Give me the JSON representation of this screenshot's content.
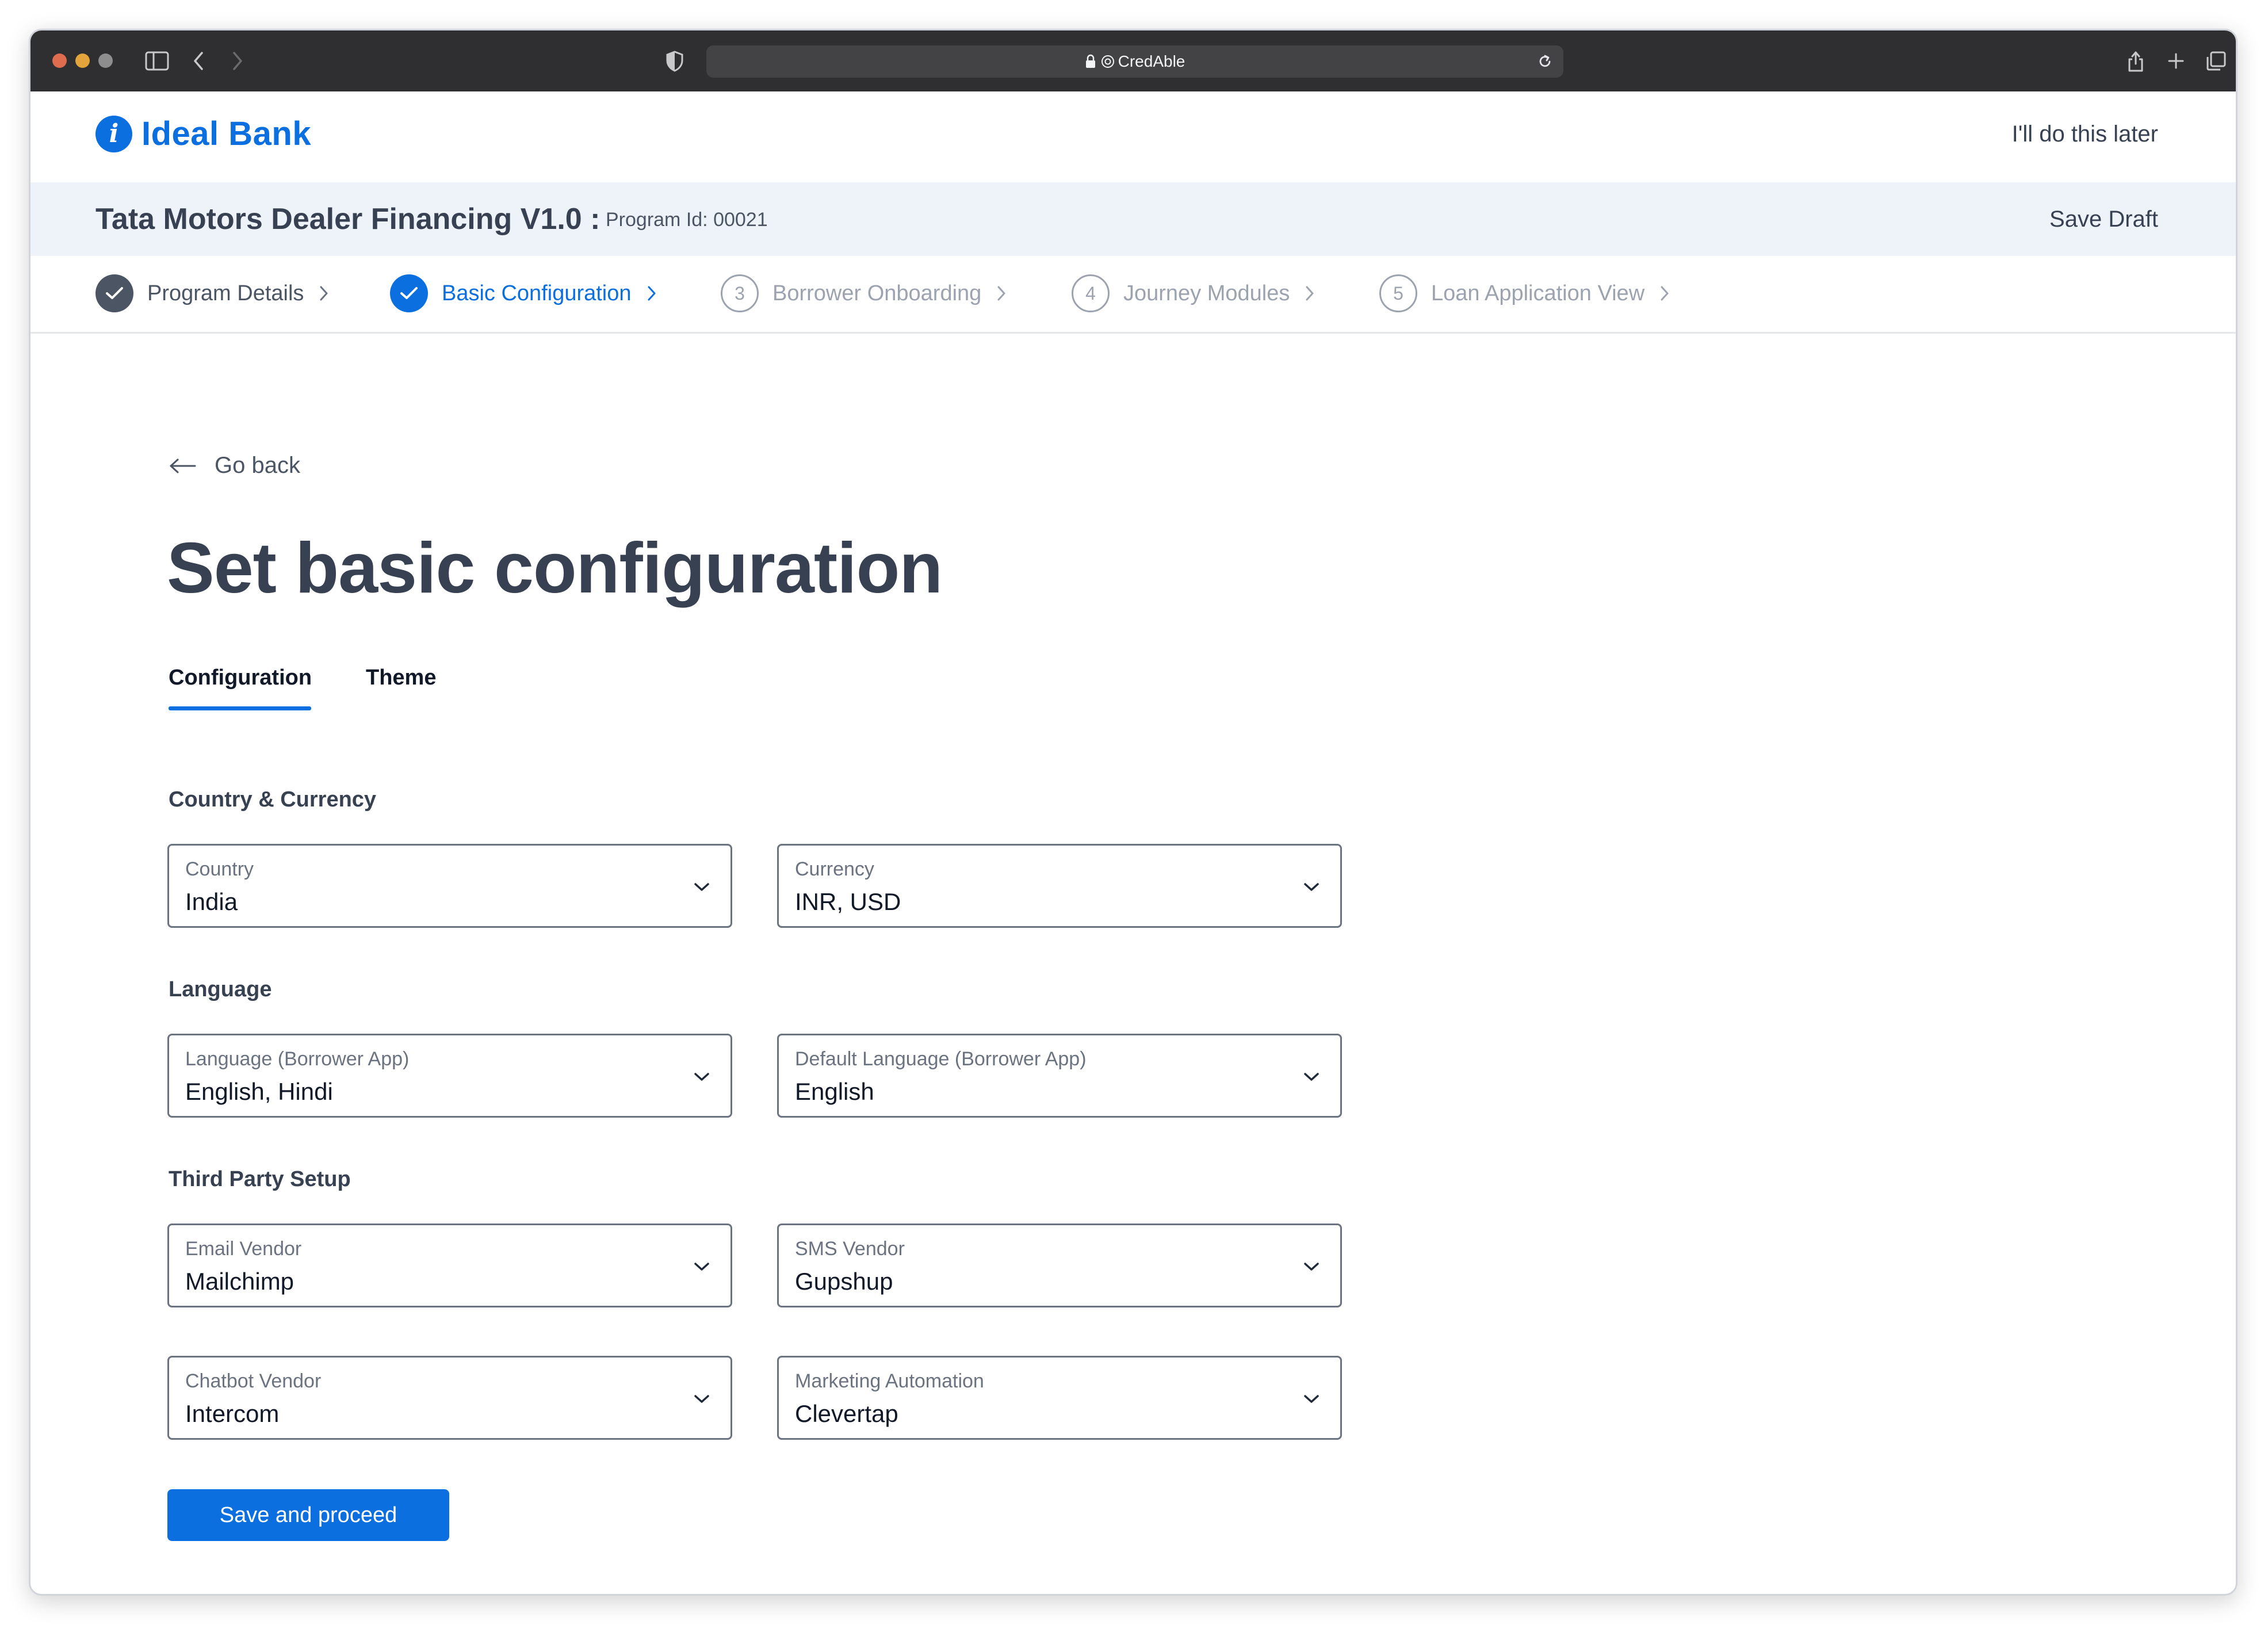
{
  "browser": {
    "url_text": "CredAble",
    "colors": {
      "close": "#e06c4f",
      "minimize": "#e3a53b",
      "zoom": "#8e8e8e"
    },
    "icons": [
      "sidebar-icon",
      "back-arrow-icon",
      "forward-arrow-icon",
      "shield-icon",
      "lock-icon",
      "reload-icon",
      "share-icon",
      "new-tab-icon",
      "tabs-overview-icon"
    ]
  },
  "header": {
    "logo_mark": "i",
    "logo_text": "Ideal Bank",
    "later_link": "I'll do this later",
    "brand_color": "#0b6fe0"
  },
  "program": {
    "title": "Tata Motors Dealer Financing V1.0 :",
    "id_text": "Program Id: 00021",
    "save_draft": "Save Draft"
  },
  "stepper": {
    "steps": [
      {
        "number": "",
        "label": "Program Details",
        "state": "completed"
      },
      {
        "number": "",
        "label": "Basic Configuration",
        "state": "active"
      },
      {
        "number": "3",
        "label": "Borrower Onboarding",
        "state": "pending"
      },
      {
        "number": "4",
        "label": "Journey Modules",
        "state": "pending"
      },
      {
        "number": "5",
        "label": "Loan Application View",
        "state": "pending"
      }
    ]
  },
  "page": {
    "go_back": "Go back",
    "title": "Set basic configuration",
    "tabs": [
      {
        "label": "Configuration",
        "active": true
      },
      {
        "label": "Theme",
        "active": false
      }
    ]
  },
  "sections": {
    "country_currency": {
      "title": "Country & Currency",
      "fields": [
        {
          "label": "Country",
          "value": "India"
        },
        {
          "label": "Currency",
          "value": "INR, USD"
        }
      ]
    },
    "language": {
      "title": "Language",
      "fields": [
        {
          "label": "Language (Borrower App)",
          "value": "English, Hindi"
        },
        {
          "label": "Default Language (Borrower App)",
          "value": "English"
        }
      ]
    },
    "third_party": {
      "title": "Third Party Setup",
      "fields": [
        {
          "label": "Email Vendor",
          "value": "Mailchimp"
        },
        {
          "label": "SMS Vendor",
          "value": "Gupshup"
        },
        {
          "label": "Chatbot Vendor",
          "value": "Intercom"
        },
        {
          "label": "Marketing Automation",
          "value": "Clevertap"
        }
      ]
    }
  },
  "actions": {
    "primary": "Save and proceed"
  }
}
